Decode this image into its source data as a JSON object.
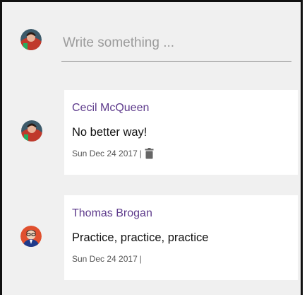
{
  "compose": {
    "placeholder": "Write something ...",
    "avatar_icon": "user-avatar-icon"
  },
  "comments": [
    {
      "author": "Cecil McQueen",
      "text": "No better way!",
      "date": "Sun Dec 24 2017",
      "separator": "|",
      "has_delete": true,
      "avatar_icon": "user-avatar-icon"
    },
    {
      "author": "Thomas Brogan",
      "text": "Practice, practice, practice",
      "date": "Sun Dec 24 2017",
      "separator": "|",
      "has_delete": false,
      "avatar_icon": "user-avatar-icon"
    }
  ],
  "colors": {
    "background": "#f0f0f0",
    "card": "#ffffff",
    "author": "#5e3b8c",
    "frame_border": "#111111"
  }
}
